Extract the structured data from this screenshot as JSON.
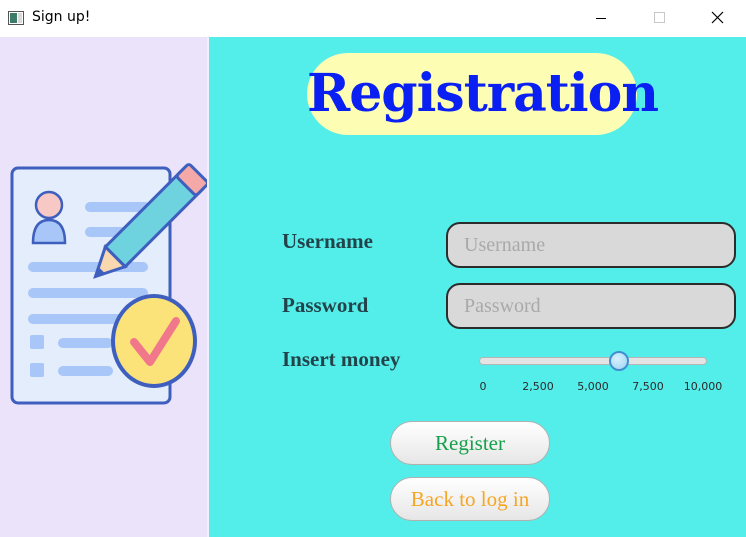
{
  "window": {
    "title": "Sign up!",
    "controls": [
      "minimize",
      "maximize",
      "close"
    ]
  },
  "illustration": {
    "icon": "registration-form-illustration",
    "colors": {
      "paper": "#e3edfb",
      "outline": "#3f5fbf",
      "lines": "#a8c6f7",
      "pencil": "#6fd3df",
      "eraser": "#f4a8a8",
      "badge": "#fbe37a",
      "check": "#f0788a"
    }
  },
  "form": {
    "heading": "Registration",
    "username_label": "Username",
    "username_placeholder": "Username",
    "username_value": "",
    "password_label": "Password",
    "password_placeholder": "Password",
    "password_value": "",
    "money_label": "Insert money",
    "money_slider": {
      "min": 0,
      "max": 10000,
      "value": 6200,
      "ticks": [
        "0",
        "2,500",
        "5,000",
        "7,500",
        "10,000"
      ]
    },
    "register_label": "Register",
    "back_label": "Back to log in"
  },
  "colors": {
    "left_panel": "#ebe3fa",
    "right_panel": "#54eeea",
    "heading_text": "#0a20f2",
    "heading_background": "#fdfeb3",
    "register_text": "#14a04a",
    "back_text": "#f6a623"
  }
}
